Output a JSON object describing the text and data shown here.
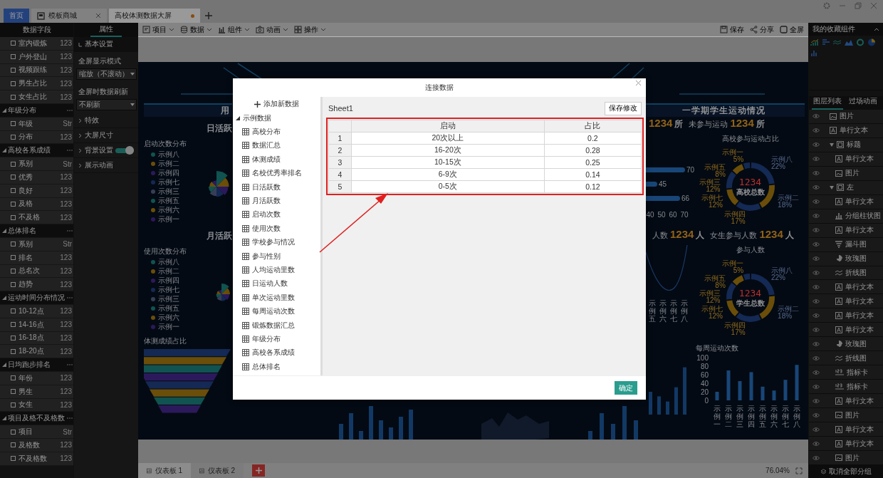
{
  "window": {
    "tabs": [
      {
        "label": "首页",
        "kind": "home",
        "selected": false
      },
      {
        "label": "模板商城",
        "kind": "store",
        "selected": false,
        "unsaved": false
      },
      {
        "label": "高校体测数据大屏",
        "kind": "document",
        "selected": true,
        "unsaved": true
      }
    ]
  },
  "data_fields": {
    "title": "数据字段",
    "groups": [
      {
        "items": [
          {
            "label": "室内锻炼",
            "type": "123",
            "checked": false
          },
          {
            "label": "户外登山",
            "type": "123",
            "checked": false
          },
          {
            "label": "视频跟练",
            "type": "123",
            "checked": false
          },
          {
            "label": "男生占比",
            "type": "123",
            "checked": false
          },
          {
            "label": "女生占比",
            "type": "123",
            "checked": false
          }
        ]
      },
      {
        "name": "年级分布",
        "expanded": true,
        "items": [
          {
            "label": "年级",
            "type": "Str",
            "checked": false
          },
          {
            "label": "分布",
            "type": "123",
            "checked": false
          }
        ]
      },
      {
        "name": "高校各系成绩",
        "expanded": true,
        "items": [
          {
            "label": "系别",
            "type": "Str",
            "checked": false
          },
          {
            "label": "优秀",
            "type": "123",
            "checked": false
          },
          {
            "label": "良好",
            "type": "123",
            "checked": false
          },
          {
            "label": "及格",
            "type": "123",
            "checked": false
          },
          {
            "label": "不及格",
            "type": "123",
            "checked": false
          }
        ]
      },
      {
        "name": "总体排名",
        "expanded": true,
        "items": [
          {
            "label": "系别",
            "type": "Str",
            "checked": false
          },
          {
            "label": "排名",
            "type": "123",
            "checked": false
          },
          {
            "label": "总名次",
            "type": "123",
            "checked": false
          },
          {
            "label": "趋势",
            "type": "123",
            "checked": false
          }
        ]
      },
      {
        "name": "运动时间分布情况",
        "expanded": true,
        "items": [
          {
            "label": "10-12点",
            "type": "123",
            "checked": false
          },
          {
            "label": "14-16点",
            "type": "123",
            "checked": false
          },
          {
            "label": "16-18点",
            "type": "123",
            "checked": false
          },
          {
            "label": "18-20点",
            "type": "123",
            "checked": false
          }
        ]
      },
      {
        "name": "日均跑步排名",
        "expanded": true,
        "items": [
          {
            "label": "年份",
            "type": "123",
            "checked": false
          },
          {
            "label": "男生",
            "type": "123",
            "checked": false
          },
          {
            "label": "女生",
            "type": "123",
            "checked": false
          }
        ]
      },
      {
        "name": "项目及格不及格数",
        "expanded": true,
        "items": [
          {
            "label": "项目",
            "type": "Str",
            "checked": false
          },
          {
            "label": "及格数",
            "type": "123",
            "checked": false
          },
          {
            "label": "不及格数",
            "type": "123",
            "checked": false
          }
        ]
      }
    ]
  },
  "properties": {
    "tab": {
      "label": "属性",
      "selected": true
    },
    "sections": [
      {
        "title": "基本设置",
        "expanded": true,
        "settings": [
          {
            "label": "全屏显示模式",
            "value": "缩放（不滚动）"
          },
          {
            "label": "全屏时数据刷新",
            "value": "不刷新"
          }
        ]
      },
      {
        "title": "特效",
        "expanded": false
      },
      {
        "title": "大屏尺寸",
        "expanded": false
      },
      {
        "title": "背景设置",
        "expanded": false,
        "switch_on": true
      },
      {
        "title": "展示动画",
        "expanded": false
      }
    ]
  },
  "toolbar": {
    "menus": [
      {
        "label": "项目",
        "kind": "project"
      },
      {
        "label": "数据",
        "kind": "data"
      },
      {
        "label": "组件",
        "kind": "component"
      },
      {
        "label": "动画",
        "kind": "animation"
      },
      {
        "label": "操作",
        "kind": "operation"
      }
    ],
    "actions": [
      {
        "label": "保存",
        "kind": "save"
      },
      {
        "label": "分享",
        "kind": "share"
      },
      {
        "label": "全屏",
        "kind": "fullscreen"
      }
    ]
  },
  "dashboard": {
    "left": {
      "panel_title": "用",
      "sections": [
        {
          "subtitle": "日活跃",
          "title": "启动次数分布",
          "legend": [
            {
              "label": "示例八",
              "color": "#105350"
            },
            {
              "label": "示例二",
              "color": "#6a4e09"
            },
            {
              "label": "示例四",
              "color": "#2c195c"
            },
            {
              "label": "示例七",
              "color": "#142953"
            },
            {
              "label": "示例三",
              "color": "#363e56"
            },
            {
              "label": "示例五",
              "color": "#105350"
            },
            {
              "label": "示例六",
              "color": "#6a4e09"
            },
            {
              "label": "示例一",
              "color": "#2c195c"
            }
          ]
        },
        {
          "subtitle": "月活跃",
          "title": "使用次数分布",
          "legend": [
            {
              "label": "示例八",
              "color": "#105350"
            },
            {
              "label": "示例二",
              "color": "#6a4e09"
            },
            {
              "label": "示例四",
              "color": "#2c195c"
            },
            {
              "label": "示例七",
              "color": "#142953"
            },
            {
              "label": "示例三",
              "color": "#363e56"
            },
            {
              "label": "示例五",
              "color": "#105350"
            },
            {
              "label": "示例六",
              "color": "#6a4e09"
            },
            {
              "label": "示例一",
              "color": "#2c195c"
            }
          ]
        },
        {
          "title": "体测成绩占比"
        }
      ]
    },
    "right": {
      "panel_title": "一学期学生运动情况",
      "stats_1": [
        {
          "value": "1234",
          "unit": "所"
        },
        {
          "label": "未参与运动",
          "value": "1234",
          "unit": "所"
        }
      ],
      "hbar": {
        "bar_labels": [
          "70",
          "45",
          "66"
        ],
        "axis_labels": [
          "40",
          "50",
          "60",
          "70"
        ]
      },
      "donut_1": {
        "title": "高校参与运动占比",
        "center_value": "1234",
        "center_label": "高校总数",
        "chart_data": {
          "type": "donut",
          "categories": [
            "示例八",
            "示例二",
            "示例四",
            "示例七",
            "示例三",
            "示例五",
            "示例一"
          ],
          "values": [
            22,
            18,
            17,
            12,
            12,
            8,
            5
          ],
          "value_labels": [
            "22%",
            "18%",
            "17%",
            "12%",
            "12%",
            "8%",
            "5%"
          ]
        }
      },
      "stats_2": [
        {
          "label": "人数",
          "value": "1234",
          "unit": "人"
        },
        {
          "label": "女生参与人数",
          "value": "1234",
          "unit": "人"
        }
      ],
      "wave_labels": [
        "示例五",
        "示例六",
        "示例七",
        "示例八"
      ],
      "donut_2": {
        "title": "参与人数",
        "center_value": "1234",
        "center_label": "学生总数",
        "chart_data": {
          "type": "donut",
          "categories": [
            "示例八",
            "示例二",
            "示例四",
            "示例七",
            "示例三",
            "示例五",
            "示例一"
          ],
          "values": [
            22,
            18,
            17,
            12,
            12,
            8,
            5
          ],
          "value_labels": [
            "22%",
            "18%",
            "17%",
            "12%",
            "12%",
            "8%",
            "5%"
          ]
        }
      },
      "weekly": {
        "title": "每周运动次数",
        "chart_data": {
          "type": "bar",
          "categories": [
            "示例一",
            "示例二",
            "示例三",
            "示例四",
            "示例五",
            "示例六",
            "示例七",
            "示例八"
          ],
          "values": [
            20,
            70,
            45,
            66,
            32,
            23,
            48,
            83
          ],
          "ylim": [
            0,
            100
          ],
          "yticks": [
            0,
            20,
            40,
            60,
            80,
            100
          ]
        }
      }
    }
  },
  "bottom_bar": {
    "tabs": [
      {
        "label": "仪表板 1",
        "selected": true
      },
      {
        "label": "仪表板 2",
        "selected": false
      }
    ],
    "zoom": "76.04%"
  },
  "right_panel": {
    "favorites_title": "我的收藏组件",
    "favorites_expanded": true,
    "tabs": [
      {
        "label": "图层列表",
        "selected": true
      },
      {
        "label": "过场动画",
        "selected": false
      }
    ],
    "layers": [
      {
        "label": "图片",
        "kind": "image"
      },
      {
        "label": "单行文本",
        "kind": "text"
      },
      {
        "label": "标题",
        "kind": "group",
        "expanded": true,
        "children": [
          {
            "label": "单行文本",
            "kind": "text"
          },
          {
            "label": "图片",
            "kind": "image"
          }
        ]
      },
      {
        "label": "左",
        "kind": "group",
        "expanded": true,
        "children": [
          {
            "label": "单行文本",
            "kind": "text"
          },
          {
            "label": "分组柱状图",
            "kind": "bar"
          },
          {
            "label": "单行文本",
            "kind": "text"
          },
          {
            "label": "漏斗图",
            "kind": "funnel"
          },
          {
            "label": "玫瑰图",
            "kind": "rose"
          },
          {
            "label": "折线图",
            "kind": "line"
          },
          {
            "label": "单行文本",
            "kind": "text"
          },
          {
            "label": "单行文本",
            "kind": "text"
          },
          {
            "label": "单行文本",
            "kind": "text"
          },
          {
            "label": "单行文本",
            "kind": "text"
          },
          {
            "label": "玫瑰图",
            "kind": "rose"
          },
          {
            "label": "折线图",
            "kind": "line"
          },
          {
            "label": "指标卡",
            "kind": "kpi"
          },
          {
            "label": "指标卡",
            "kind": "kpi"
          },
          {
            "label": "单行文本",
            "kind": "text"
          },
          {
            "label": "图片",
            "kind": "image"
          },
          {
            "label": "单行文本",
            "kind": "text"
          },
          {
            "label": "单行文本",
            "kind": "text"
          },
          {
            "label": "图片",
            "kind": "image"
          }
        ]
      }
    ],
    "footer": "取消全部分组"
  },
  "dialog": {
    "title": "连接数据",
    "add_label": "添加新数据",
    "tree": {
      "label": "示例数据",
      "expanded": true,
      "children": [
        "高校分布",
        "数据汇总",
        "体测成绩",
        "名校优秀率排名",
        "日活跃数",
        "月活跃数",
        "启动次数",
        "使用次数",
        "学校参与情况",
        "参与性别",
        "人均运动里数",
        "日运动人数",
        "单次运动里数",
        "每周运动次数",
        "锻炼数据汇总",
        "年级分布",
        "高校各系成绩",
        "总体排名"
      ]
    },
    "sheet": "Sheet1",
    "save_label": "保存修改",
    "table": {
      "columns": [
        "",
        "启动",
        "占比"
      ],
      "rows": [
        [
          "1",
          "20次以上",
          "0.2"
        ],
        [
          "2",
          "16-20次",
          "0.28"
        ],
        [
          "3",
          "10-15次",
          "0.25"
        ],
        [
          "4",
          "6-9次",
          "0.14"
        ],
        [
          "5",
          "0-5次",
          "0.12"
        ]
      ]
    },
    "confirm_label": "确定"
  }
}
